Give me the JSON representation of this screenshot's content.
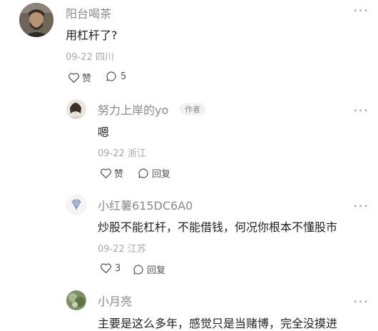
{
  "comments": [
    {
      "author": "阳台喝茶",
      "text": "用杠杆了?",
      "date": "09-22",
      "location": "四川",
      "like_label": "赞",
      "reply_label": "5"
    },
    {
      "author": "努力上岸的yo",
      "author_badge": "作者",
      "text": "嗯",
      "date": "09-22",
      "location": "浙江",
      "like_label": "赞",
      "reply_label": "回复"
    },
    {
      "author": "小红薯615DC6A0",
      "text": "炒股不能杠杆，不能借钱，何况你根本不懂股市",
      "date": "09-22",
      "location": "江苏",
      "like_label": "3",
      "reply_label": "回复"
    },
    {
      "author": "小月亮",
      "text": "主要是这么多年，感觉只是当赌博，完全没摸进"
    }
  ],
  "colors": {
    "name": "#8a8a8a",
    "meta": "#a8a8a8",
    "text": "#222222"
  },
  "icons": [
    "more-icon",
    "heart-icon",
    "comment-icon",
    "diamond-avatar-icon"
  ]
}
